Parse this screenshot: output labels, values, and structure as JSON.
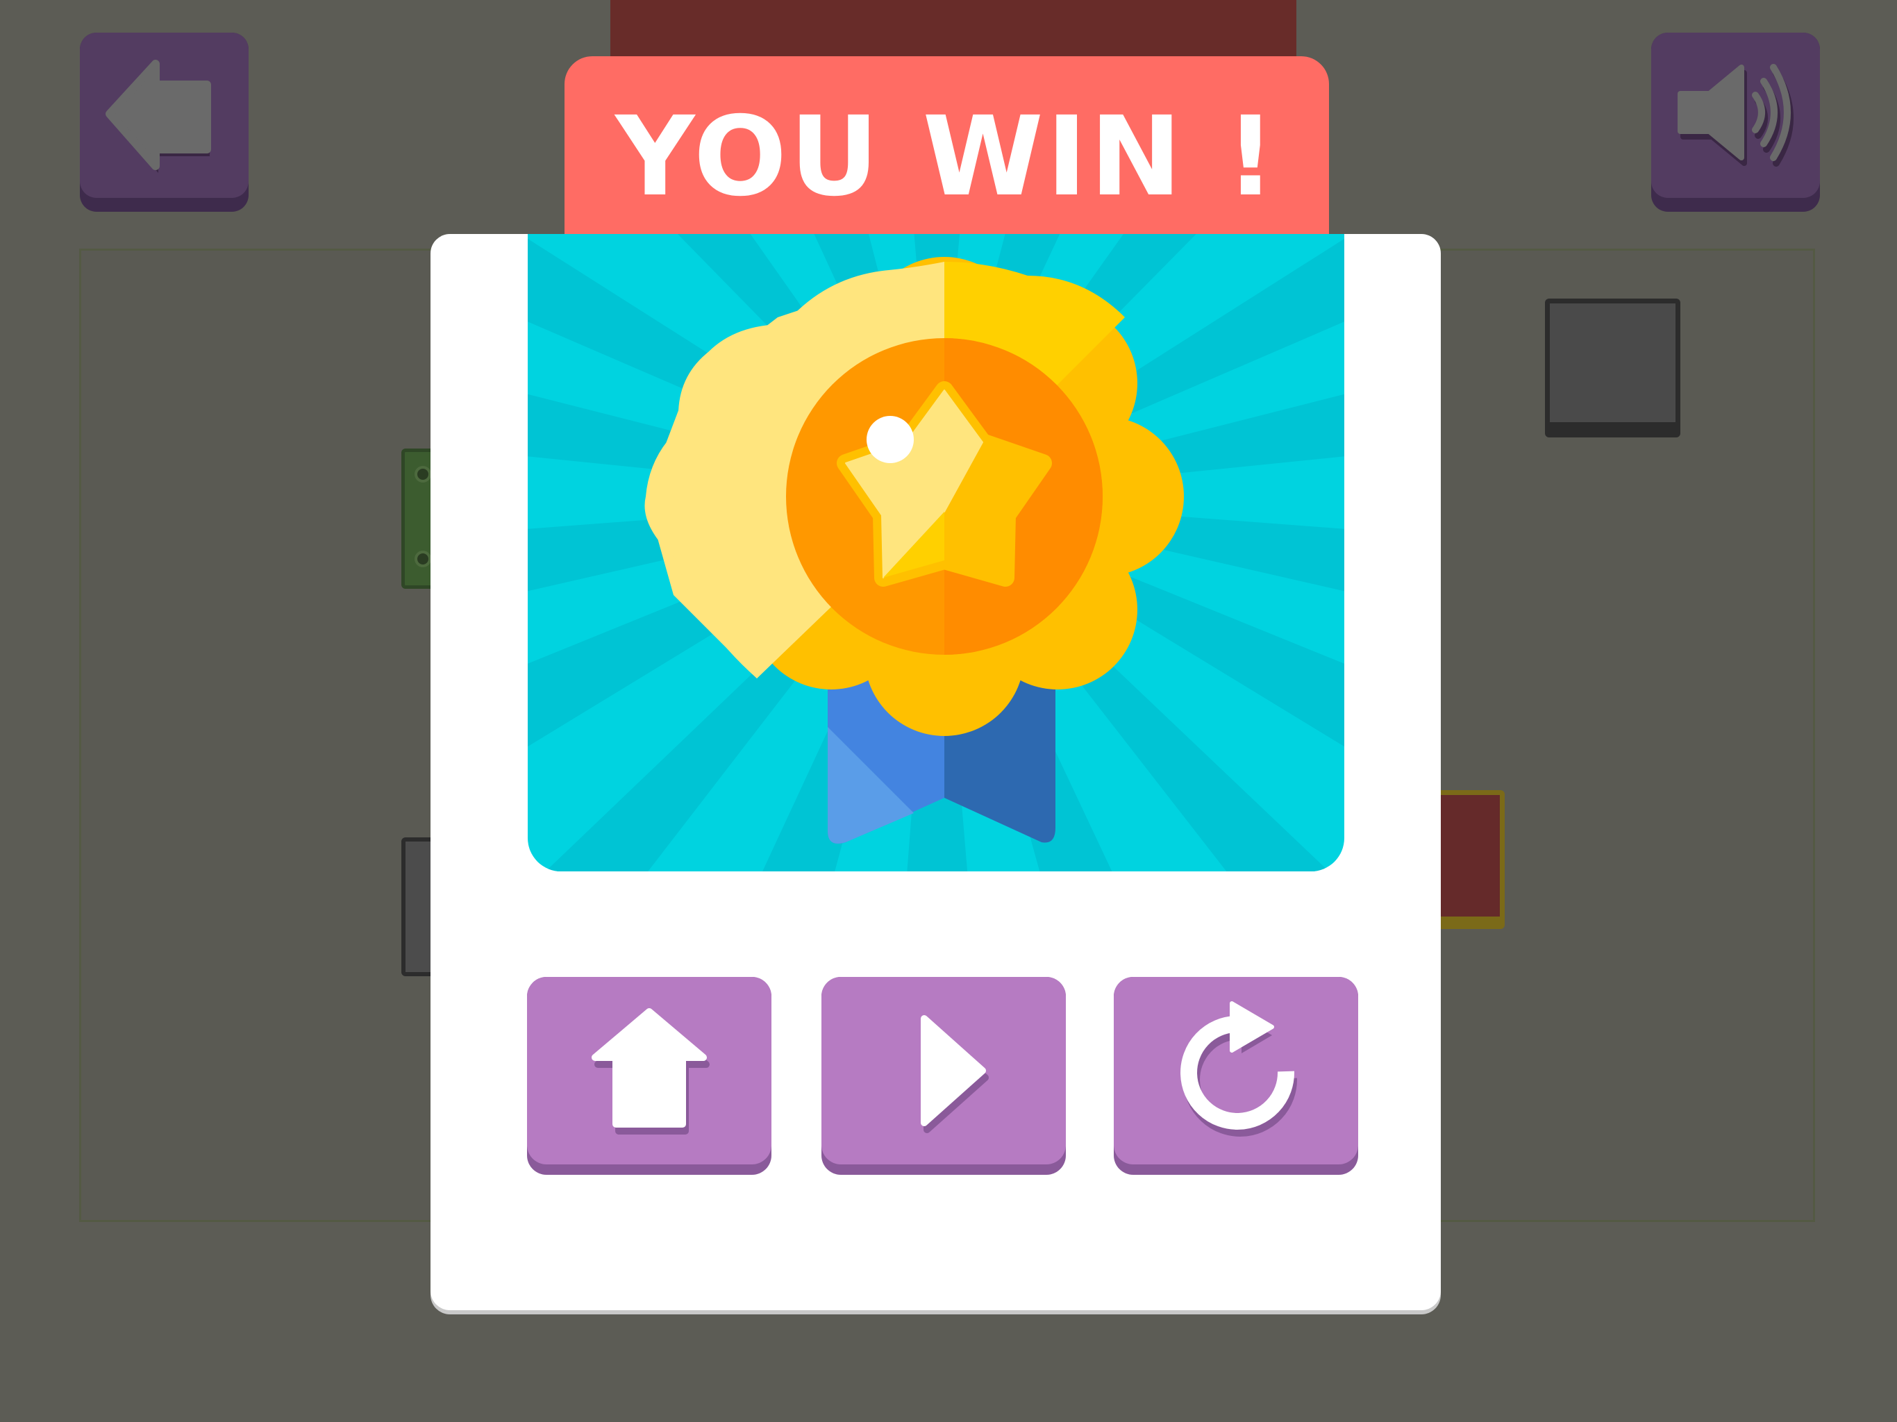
{
  "dialog": {
    "title": "YOU WIN !"
  },
  "icons": {
    "back": "back-arrow-icon",
    "sound": "speaker-icon",
    "home": "home-icon",
    "next": "play-icon",
    "replay": "replay-icon",
    "reward": "medal-badge-icon"
  },
  "colors": {
    "banner": "#ff6c64",
    "button": "#b67bc2",
    "art_background": "#00d3e0",
    "medal_gold": "#ffc000",
    "ribbon_blue": "#4384e0"
  }
}
